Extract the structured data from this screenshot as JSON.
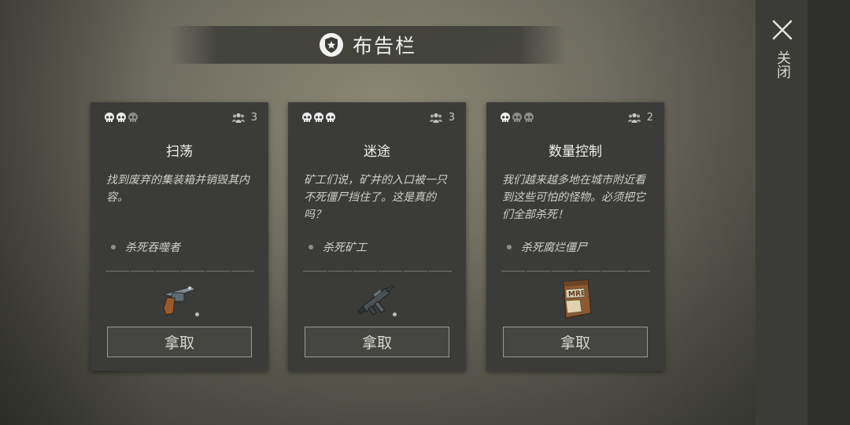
{
  "header": {
    "title": "布告栏",
    "badge_icon": "star-shield-icon"
  },
  "close": {
    "icon": "close-icon",
    "label": "关闭"
  },
  "cards": [
    {
      "difficulty": 2,
      "difficulty_max": 3,
      "players": "3",
      "name": "扫荡",
      "description": "找到废弃的集装箱并销毁其内容。",
      "objective": "杀死吞噬者",
      "reward_icon": "revolver-icon",
      "button": "拿取"
    },
    {
      "difficulty": 3,
      "difficulty_max": 3,
      "players": "3",
      "name": "迷途",
      "description": "矿工们说，矿井的入口被一只不死僵尸挡住了。这是真的吗？",
      "objective": "杀死矿工",
      "reward_icon": "submachine-gun-icon",
      "button": "拿取"
    },
    {
      "difficulty": 1,
      "difficulty_max": 3,
      "players": "2",
      "name": "数量控制",
      "description": "我们越来越多地在城市附近看到这些可怕的怪物。必须把它们全部杀死！",
      "objective": "杀死腐烂僵尸",
      "reward_icon": "mre-ration-icon",
      "reward_label": "MRE",
      "button": "拿取"
    }
  ],
  "colors": {
    "skull_active": "#ececec",
    "skull_inactive": "#8d8d88"
  }
}
